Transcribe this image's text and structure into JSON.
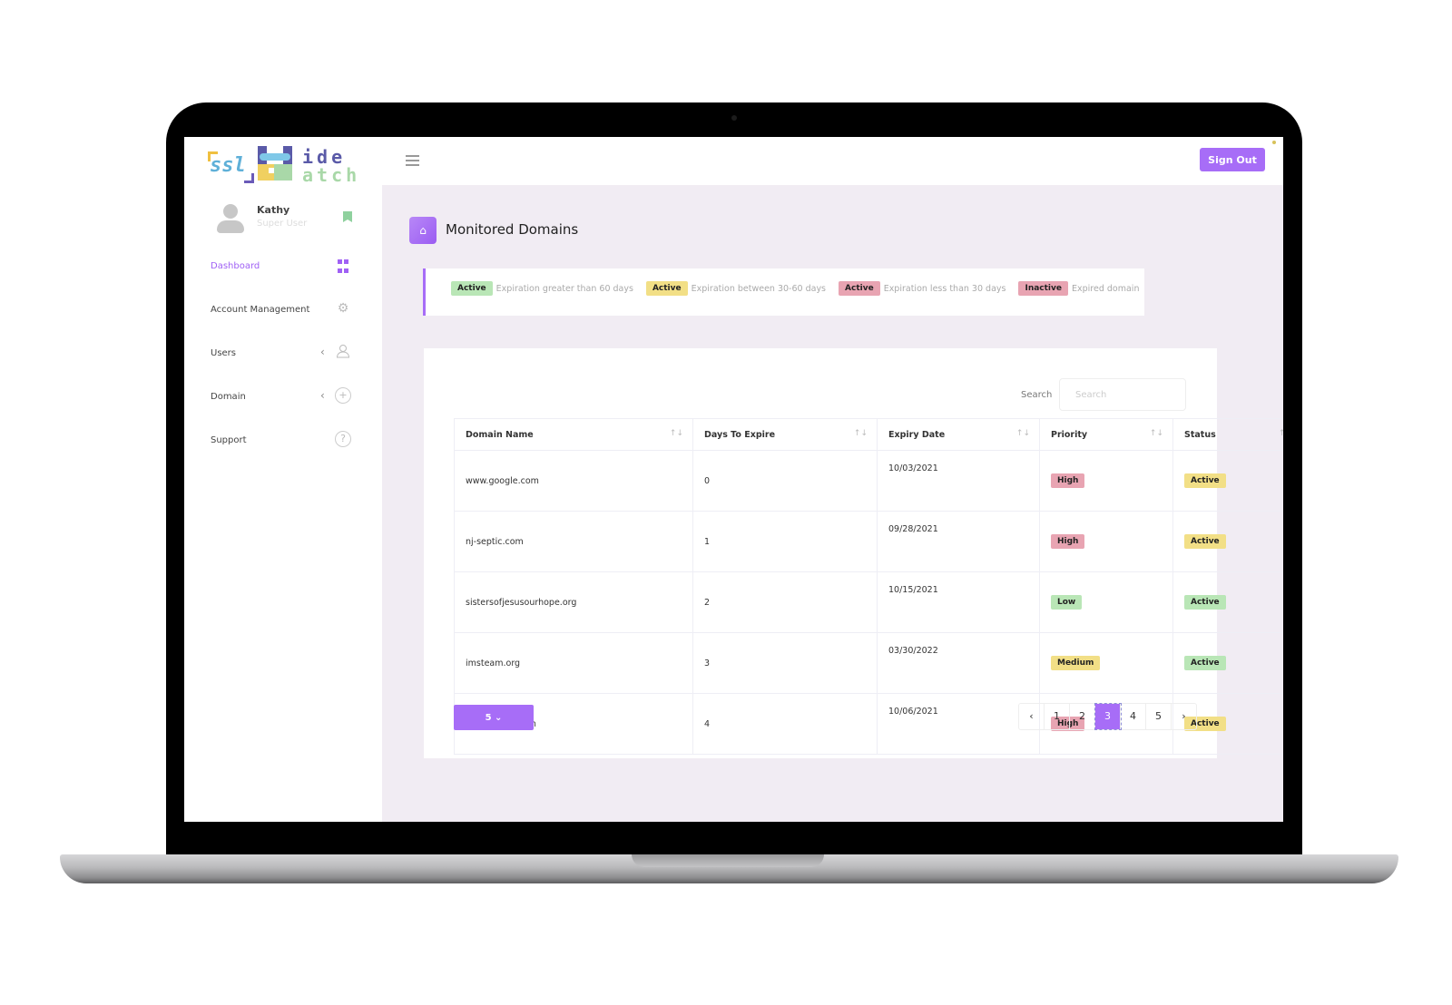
{
  "brand": {
    "logo_prefix": "ssl",
    "logo_line1": "ide",
    "logo_line2": "atch"
  },
  "user": {
    "name": "Kathy",
    "role": "Super User"
  },
  "sidebar": {
    "items": [
      {
        "label": "Dashboard",
        "icon": "dashboard-grid-icon",
        "active": true
      },
      {
        "label": "Account Management",
        "icon": "gear-icon"
      },
      {
        "label": "Users",
        "icon": "user-icon",
        "expandable": true
      },
      {
        "label": "Domain",
        "icon": "plus-circle-icon",
        "expandable": true
      },
      {
        "label": "Support",
        "icon": "help-circle-icon"
      }
    ],
    "chevron": "‹"
  },
  "topbar": {
    "signout_label": "Sign Out"
  },
  "page": {
    "title": "Monitored Domains"
  },
  "legend": [
    {
      "badge": "Active",
      "color": "green",
      "text": "Expiration greater than 60 days"
    },
    {
      "badge": "Active",
      "color": "yellow",
      "text": "Expiration between 30-60 days"
    },
    {
      "badge": "Active",
      "color": "red",
      "text": "Expiration less than 30 days"
    },
    {
      "badge": "Inactive",
      "color": "red",
      "text": "Expired domain"
    }
  ],
  "search": {
    "label": "Search",
    "placeholder": "Search",
    "value": ""
  },
  "table": {
    "columns": [
      "Domain Name",
      "Days To Expire",
      "Expiry Date",
      "Priority",
      "Status"
    ],
    "sort_icon": "↑↓",
    "rows": [
      {
        "domain": "www.google.com",
        "days": "0",
        "date": "10/03/2021",
        "priority": "High",
        "priority_color": "red",
        "status": "Active",
        "status_color": "yellow"
      },
      {
        "domain": "nj-septic.com",
        "days": "1",
        "date": "09/28/2021",
        "priority": "High",
        "priority_color": "red",
        "status": "Active",
        "status_color": "yellow"
      },
      {
        "domain": "sistersofjesusourhope.org",
        "days": "2",
        "date": "10/15/2021",
        "priority": "Low",
        "priority_color": "green",
        "status": "Active",
        "status_color": "green"
      },
      {
        "domain": "imsteam.org",
        "days": "3",
        "date": "03/30/2022",
        "priority": "Medium",
        "priority_color": "yellow",
        "status": "Active",
        "status_color": "green"
      },
      {
        "domain": "lab.njseptic.com",
        "days": "4",
        "date": "10/06/2021",
        "priority": "High",
        "priority_color": "red",
        "status": "Active",
        "status_color": "yellow"
      }
    ]
  },
  "pagination": {
    "per_page_label": "5 ⌄",
    "prev": "‹",
    "next": "›",
    "pages": [
      "1",
      "2",
      "3",
      "4",
      "5"
    ],
    "current": "3"
  },
  "colors": {
    "accent": "#a76df7",
    "green": "#b9e6b6",
    "yellow": "#f2df86",
    "red": "#e8a4b2",
    "main_bg": "#f1ecf3"
  }
}
